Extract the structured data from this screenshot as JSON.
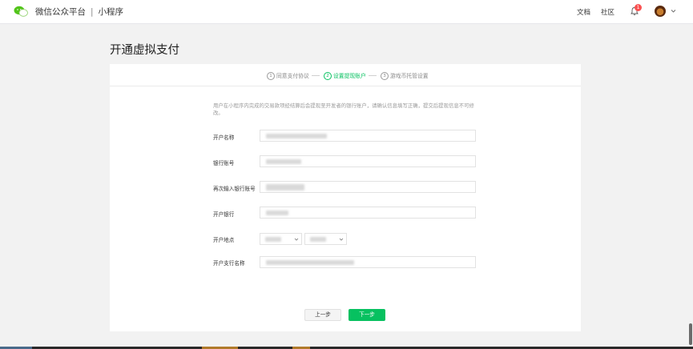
{
  "header": {
    "brand_name": "微信公众平台",
    "separator": "|",
    "product_name": "小程序",
    "nav_docs": "文档",
    "nav_community": "社区",
    "notification_count": "1",
    "logo_icon": "wechat-logo-icon",
    "bell_icon": "bell-icon",
    "avatar_icon": "user-avatar"
  },
  "page": {
    "title": "开通虚拟支付"
  },
  "steps": [
    {
      "num": "1",
      "label": "同意支付协议",
      "state": "done"
    },
    {
      "num": "2",
      "label": "设置提现账户",
      "state": "active"
    },
    {
      "num": "3",
      "label": "游戏币托管设置",
      "state": "pending"
    }
  ],
  "form": {
    "description": "用户在小程序内完成的交易款项经结算后会提现至开发者的银行账户，请确认信息填写正确，提交后提现信息不可修改。",
    "account_name_label": "开户名称",
    "account_number_label": "银行账号",
    "account_number_confirm_label": "再次输入银行账号",
    "bank_label": "开户银行",
    "location_label": "开户地点",
    "branch_label": "开户支行名称"
  },
  "actions": {
    "prev_label": "上一步",
    "next_label": "下一步"
  },
  "colors": {
    "accent": "#07c160",
    "badge": "#fa5151",
    "background": "#f2f2f2"
  }
}
